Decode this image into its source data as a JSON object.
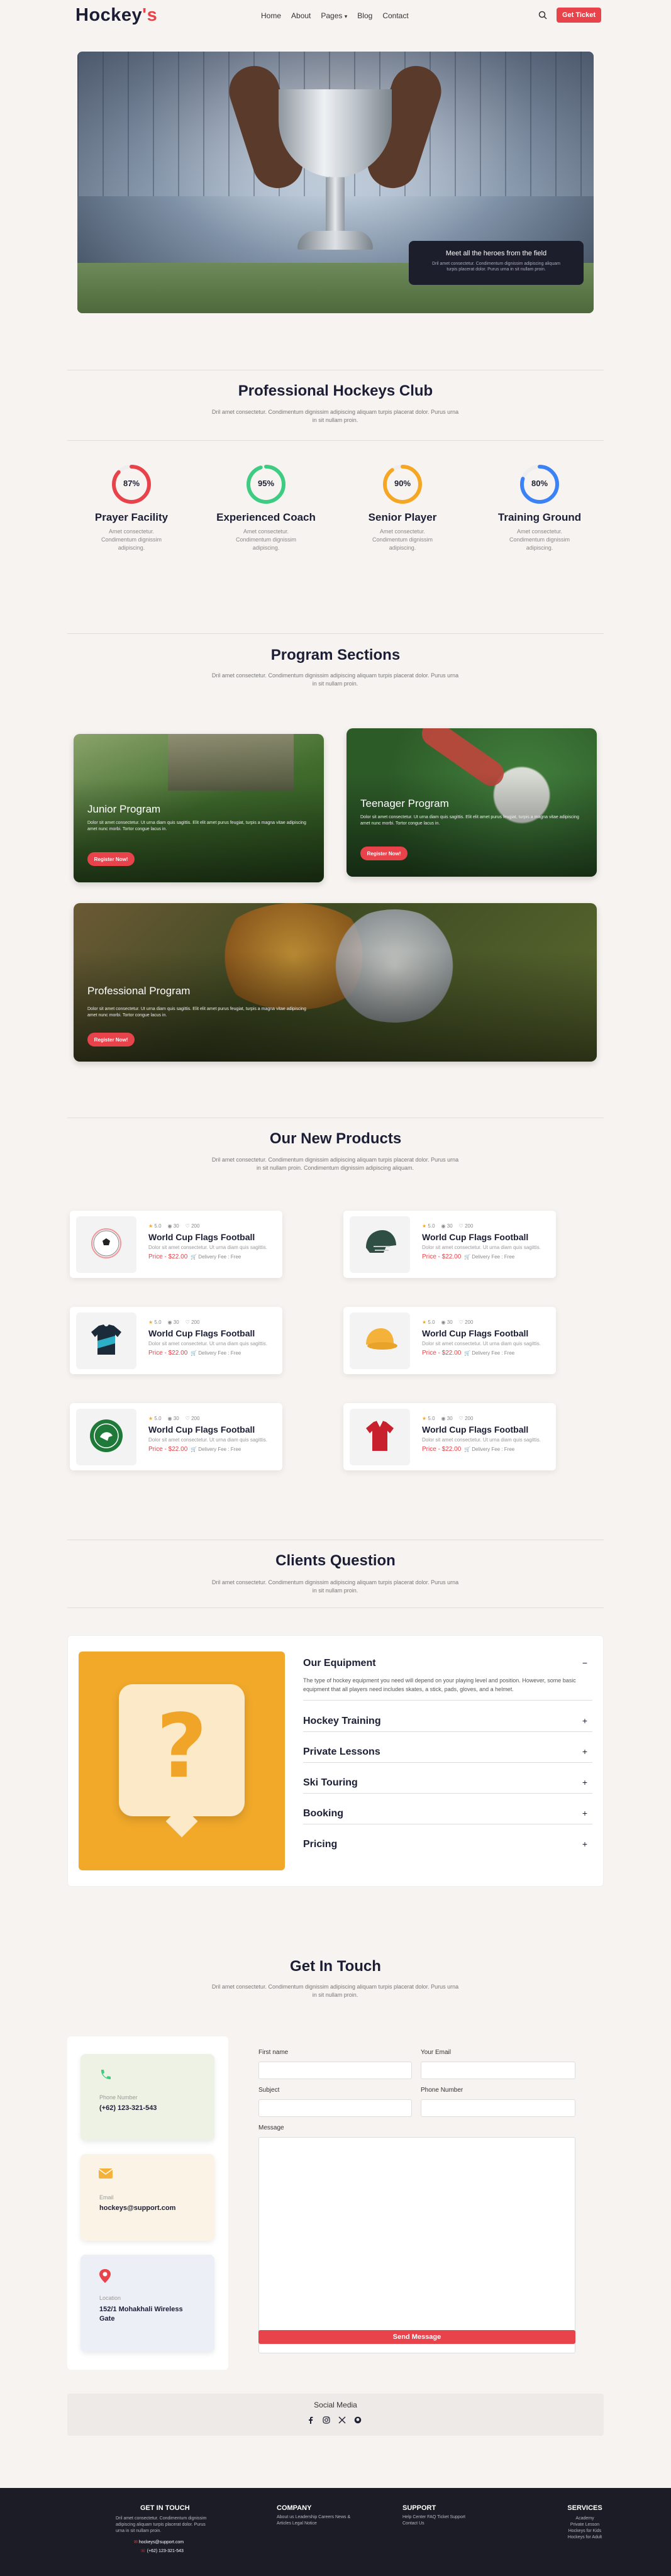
{
  "header": {
    "logo_text": "Hockey",
    "logo_mark": "'s",
    "nav": [
      "Home",
      "About",
      "Pages",
      "Blog",
      "Contact"
    ],
    "nav_pages_caret": "▾",
    "cta": "Get Ticket"
  },
  "hero": {
    "card_title": "Meet all the heroes from the field",
    "card_desc": "Dril amet consectetur. Condimentum dignissim adipiscing aliquam turpis placerat dolor. Purus urna in sit nullam proin."
  },
  "club": {
    "title": "Professional Hockeys Club",
    "desc": "Dril amet consectetur. Condimentum dignissim adipiscing aliquam turpis placerat dolor. Purus urna in sit nullam proin.",
    "stats": [
      {
        "pct": "87%",
        "value": 87,
        "label": "Prayer Facility",
        "desc": "Amet consectetur. Condimentum dignissim adipiscing.",
        "color": "#e8424a"
      },
      {
        "pct": "95%",
        "value": 95,
        "label": "Experienced Coach",
        "desc": "Amet consectetur. Condimentum dignissim adipiscing.",
        "color": "#3ecb82"
      },
      {
        "pct": "90%",
        "value": 90,
        "label": "Senior Player",
        "desc": "Amet consectetur. Condimentum dignissim adipiscing.",
        "color": "#f5a623"
      },
      {
        "pct": "80%",
        "value": 80,
        "label": "Training Ground",
        "desc": "Amet consectetur. Condimentum dignissim adipiscing.",
        "color": "#3b82f6"
      }
    ]
  },
  "programs": {
    "title": "Program Sections",
    "desc": "Dril amet consectetur. Condimentum dignissim adipiscing aliquam turpis placerat dolor. Purus urna in sit nullam proin.",
    "items": [
      {
        "title": "Junior Program",
        "desc": "Dolor sit amet consectetur. Ut urna diam quis sagittis. Elit elit amet purus feugiat, turpis a magna vitae adipiscing amet nunc morbi. Tortor congue lacus in.",
        "cta": "Register Now!"
      },
      {
        "title": "Teenager Program",
        "desc": "Dolor sit amet consectetur. Ut urna diam quis sagittis. Elit elit amet purus feugiat, turpis a magna vitae adipiscing amet nunc morbi. Tortor congue lacus in.",
        "cta": "Register Now!"
      },
      {
        "title": "Professional Program",
        "desc": "Dolor sit amet consectetur. Ut urna diam quis sagittis. Elit elit amet purus feugiat, turpis a magna vitae adipiscing amet nunc morbi. Tortor congue lacus in.",
        "cta": "Register Now!"
      }
    ]
  },
  "products": {
    "title": "Our New Products",
    "desc": "Dril amet consectetur. Condimentum dignissim adipiscing aliquam turpis placerat dolor. Purus urna in sit nullam proin. Condimentum dignissim adipiscing aliquam.",
    "items": [
      {
        "rating": "5.0",
        "views": "30",
        "likes": "200",
        "name": "World Cup Flags Football",
        "desc": "Dolor sit amet consectetur. Ut urna diam quis sagittis.",
        "price": "Price - $22.00",
        "delivery": "Delivery Fee : Free",
        "icon": "soccer-ball-icon"
      },
      {
        "rating": "5.0",
        "views": "30",
        "likes": "200",
        "name": "World Cup Flags Football",
        "desc": "Dolor sit amet consectetur. Ut urna diam quis sagittis.",
        "price": "Price - $22.00",
        "delivery": "Delivery Fee : Free",
        "icon": "helmet-icon"
      },
      {
        "rating": "5.0",
        "views": "30",
        "likes": "200",
        "name": "World Cup Flags Football",
        "desc": "Dolor sit amet consectetur. Ut urna diam quis sagittis.",
        "price": "Price - $22.00",
        "delivery": "Delivery Fee : Free",
        "icon": "jersey-icon"
      },
      {
        "rating": "5.0",
        "views": "30",
        "likes": "200",
        "name": "World Cup Flags Football",
        "desc": "Dolor sit amet consectetur. Ut urna diam quis sagittis.",
        "price": "Price - $22.00",
        "delivery": "Delivery Fee : Free",
        "icon": "cap-icon"
      },
      {
        "rating": "5.0",
        "views": "30",
        "likes": "200",
        "name": "World Cup Flags Football",
        "desc": "Dolor sit amet consectetur. Ut urna diam quis sagittis.",
        "price": "Price - $22.00",
        "delivery": "Delivery Fee : Free",
        "icon": "badge-icon"
      },
      {
        "rating": "5.0",
        "views": "30",
        "likes": "200",
        "name": "World Cup Flags Football",
        "desc": "Dolor sit amet consectetur. Ut urna diam quis sagittis.",
        "price": "Price - $22.00",
        "delivery": "Delivery Fee : Free",
        "icon": "shirt-icon"
      }
    ]
  },
  "faq": {
    "title": "Clients Question",
    "desc": "Dril amet consectetur. Condimentum dignissim adipiscing aliquam turpis placerat dolor. Purus urna in sit nullam proin.",
    "open": {
      "q": "Our Equipment",
      "a": "The type of hockey equipment you need will depend on your playing level and position. However, some basic equipment that all players need includes skates, a stick, pads, gloves, and a helmet.",
      "toggle": "−"
    },
    "items": [
      {
        "q": "Hockey Training",
        "toggle": "+"
      },
      {
        "q": "Private Lessons",
        "toggle": "+"
      },
      {
        "q": "Ski Touring",
        "toggle": "+"
      },
      {
        "q": "Booking",
        "toggle": "+"
      },
      {
        "q": "Pricing",
        "toggle": "+"
      }
    ]
  },
  "contact": {
    "title": "Get In Touch",
    "desc": "Dril amet consectetur. Condimentum dignissim adipiscing aliquam turpis placerat dolor. Purus urna in sit nullam proin.",
    "cards": [
      {
        "label": "Phone Number",
        "value": "(+62) 123-321-543",
        "icon": "phone-icon"
      },
      {
        "label": "Email",
        "value": "hockeys@support.com",
        "icon": "mail-icon"
      },
      {
        "label": "Location",
        "value": "152/1 Mohakhali Wireless Gate",
        "icon": "location-icon"
      }
    ],
    "form": {
      "first_name": "First name",
      "email": "Your Email",
      "subject": "Subject",
      "phone": "Phone Number",
      "message": "Message",
      "submit": "Send Message"
    }
  },
  "social": {
    "title": "Social Media",
    "icons": [
      "facebook-icon",
      "instagram-icon",
      "x-icon",
      "github-icon"
    ]
  },
  "footer": {
    "touch": {
      "title": "GET IN TOUCH",
      "text": "Dril amet consectetur. Condimentum dignissim adipiscing aliquam turpis placerat dolor. Purus urna in sit nullam proin.",
      "email": "hockeys@support.com",
      "phone": "(+62) 123-321-543"
    },
    "company": {
      "title": "COMPANY",
      "text": "About us Leadership Careers News & Articles Legal Notice"
    },
    "support": {
      "title": "SUPPORT",
      "text": "Help Center FAQ Ticket Support Contact Us"
    },
    "services": {
      "title": "SERVICES",
      "items": [
        "Academy",
        "Private Lesson",
        "Hockeys for Kids",
        "Hockeys for Adult"
      ]
    }
  }
}
